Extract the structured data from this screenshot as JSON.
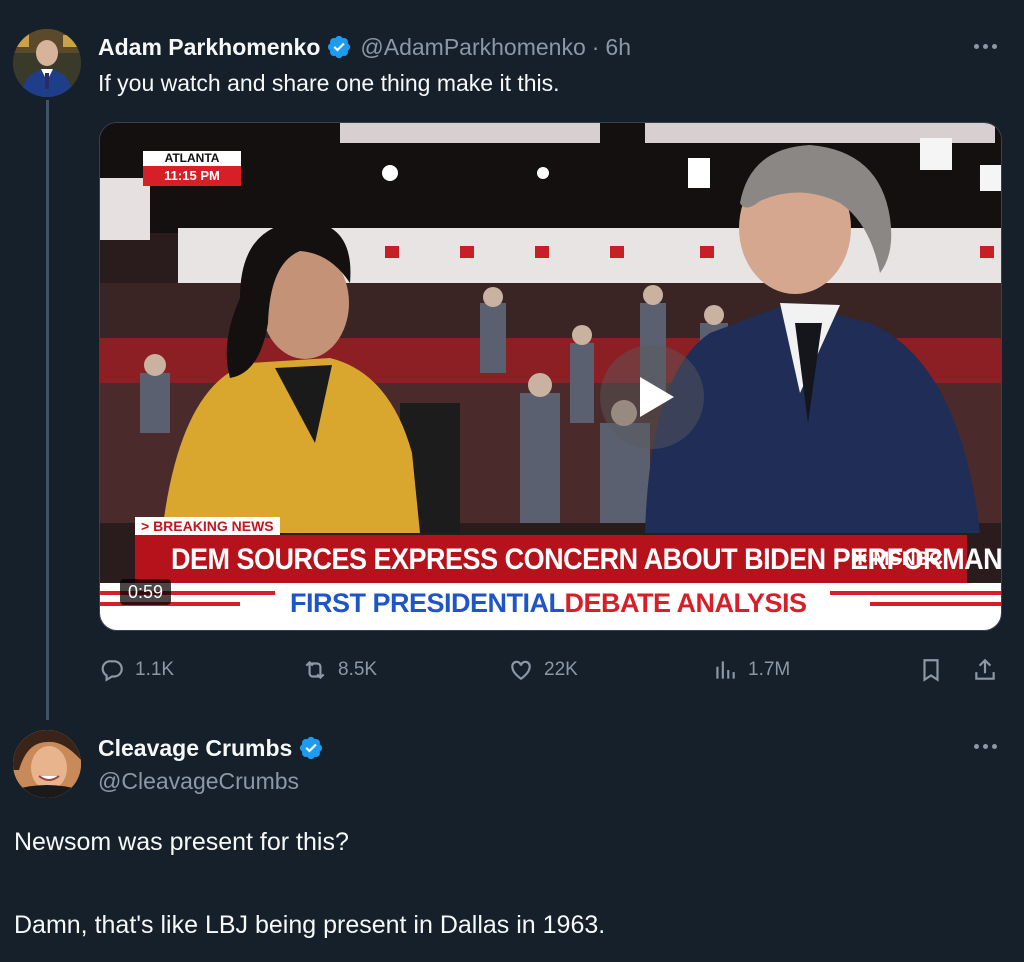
{
  "tweet": {
    "display_name": "Adam Parkhomenko",
    "handle": "@AdamParkhomenko",
    "separator": "·",
    "time": "6h",
    "text": "If you watch and share one thing make it this.",
    "verified_icon": "verified-badge-icon",
    "video": {
      "location": "ATLANTA",
      "clock": "11:15 PM",
      "breaking_label": "> BREAKING NEWS",
      "headline": "DEM SOURCES EXPRESS CONCERN ABOUT BIDEN PERFORMANCE",
      "network": "MSNBC",
      "subhead_part1": "FIRST PRESIDENTIAL",
      "subhead_part2": "DEBATE ANALYSIS",
      "duration": "0:59",
      "colors": {
        "banner_red": "#b5121b",
        "subhead_blue": "#1f56c7",
        "subhead_red": "#d71f2a",
        "jacket_yellow": "#d9a62e",
        "suit_navy": "#1f2d57"
      }
    },
    "actions": {
      "replies": "1.1K",
      "reposts": "8.5K",
      "likes": "22K",
      "views": "1.7M"
    }
  },
  "reply": {
    "display_name": "Cleavage Crumbs",
    "handle": "@CleavageCrumbs",
    "text_line1": "Newsom was present for this?",
    "text_line2": "Damn, that's like LBJ being present in Dallas in 1963."
  },
  "colors": {
    "background": "#15202b",
    "secondary_text": "#8b98a5",
    "verified_blue": "#1d9bf0"
  }
}
